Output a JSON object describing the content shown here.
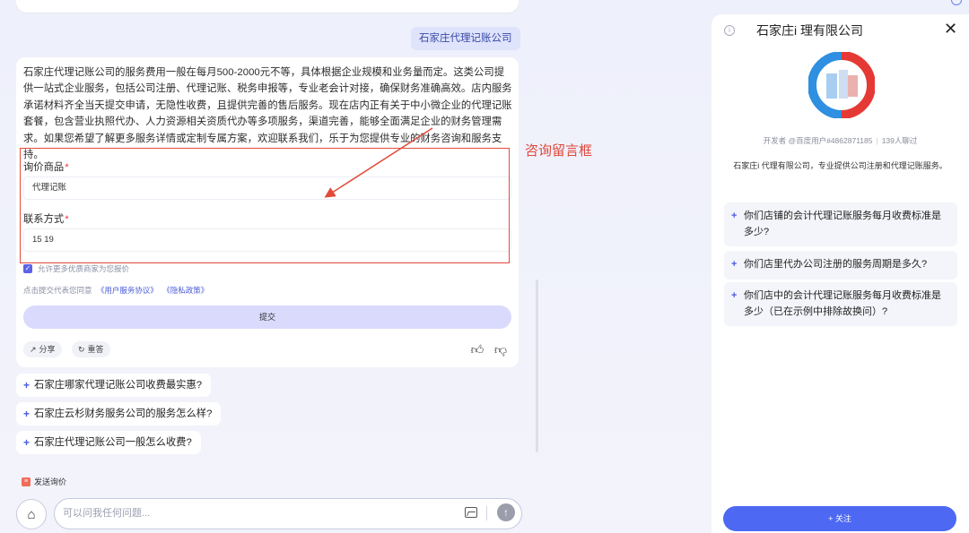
{
  "chat": {
    "user_query": "石家庄代理记账公司",
    "answer_text": "石家庄代理记账公司的服务费用一般在每月500-2000元不等，具体根据企业规模和业务量而定。这类公司提供一站式企业服务，包括公司注册、代理记账、税务申报等，专业老会计对接，确保财务准确高效。店内服务承诺材料齐全当天提交申请，无隐性收费，且提供完善的售后服务。现在店内正有关于中小微企业的代理记账套餐，包含营业执照代办、人力资源相关资质代办等多项服务，渠道完善，能够全面满足企业的财务管理需求。如果您希望了解更多服务详情或定制专属方案，欢迎联系我们，乐于为您提供专业的财务咨询和服务支持。",
    "form": {
      "product_label": "询价商品",
      "product_value": "代理记账",
      "contact_label": "联系方式",
      "contact_value": "15        19",
      "required_mark": "*",
      "agree_text": "允许更多优质商家为您报价",
      "agree_checked": true,
      "policy_prefix": "点击提交代表您同意",
      "policy_user": "《用户服务协议》",
      "policy_privacy": "《隐私政策》",
      "submit_label": "提交"
    },
    "actions": {
      "share_label": "分享",
      "regenerate_label": "重答"
    },
    "suggestions": [
      "石家庄哪家代理记账公司收费最实惠?",
      "石家庄云杉财务服务公司的服务怎么样?",
      "石家庄代理记账公司一般怎么收费?"
    ],
    "send_inquiry_label": "发送询价",
    "input_placeholder": "可以问我任何问题..."
  },
  "annotation": {
    "label": "咨询留言框",
    "color": "#e24b3b"
  },
  "panel": {
    "title": "石家庄i           理有限公司",
    "developer": "开发者 @百度用户#4862871185",
    "chat_count": "139人聊过",
    "description": "石家庄i              代理有限公司，专业提供公司注册和代理记账服务。",
    "questions": [
      "你们店铺的会计代理记账服务每月收费标准是多少?",
      "你们店里代办公司注册的服务周期是多久?",
      "你们店中的会计代理记账服务每月收费标准是多少（已在示例中排除故换问）?"
    ],
    "follow_label": "+ 关注"
  },
  "colors": {
    "accent": "#4d68f3",
    "annotation_red": "#e24b3b",
    "submit_bg": "#d9dafc"
  }
}
